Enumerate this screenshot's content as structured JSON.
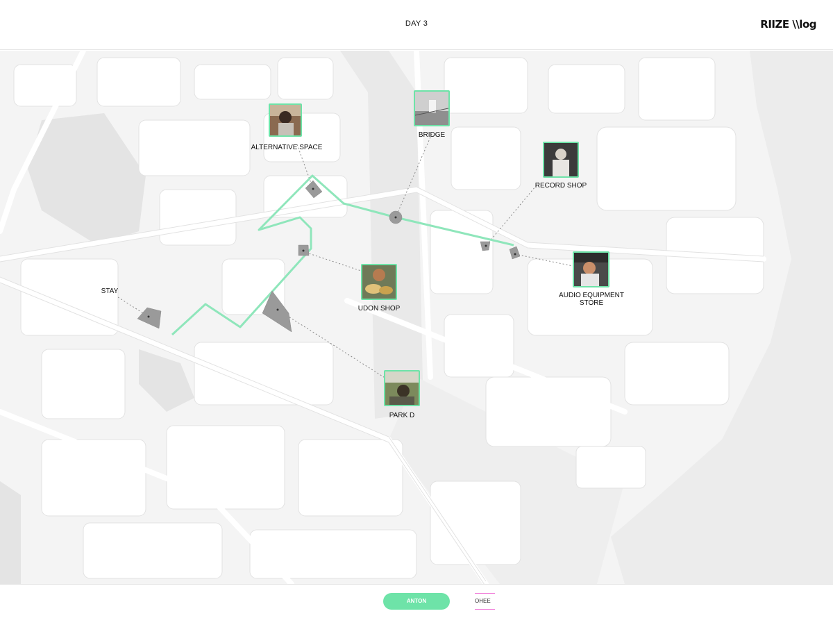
{
  "header": {
    "title": "DAY 3",
    "logo": "RIIZE \\\\log"
  },
  "map": {
    "route_color": "#8fe6bb",
    "marker_color": "#9a9a9a",
    "places": [
      {
        "id": "alternative-space",
        "label": "ALTERNATIVE SPACE"
      },
      {
        "id": "bridge",
        "label": "BRIDGE"
      },
      {
        "id": "record-shop",
        "label": "RECORD SHOP"
      },
      {
        "id": "udon-shop",
        "label": "UDON SHOP"
      },
      {
        "id": "audio-equipment-store",
        "label": "AUDIO EQUIPMENT STORE"
      },
      {
        "id": "park-d",
        "label": "PARK D"
      }
    ],
    "stay_label": "STAY",
    "accent_border": "#6ee3a8"
  },
  "footer": {
    "tabs": [
      {
        "label": "ANTON",
        "active": true
      },
      {
        "label": "OHEE",
        "active": false
      }
    ],
    "active_color": "#6ee3a8",
    "inactive_accent": "#f07ad8"
  }
}
